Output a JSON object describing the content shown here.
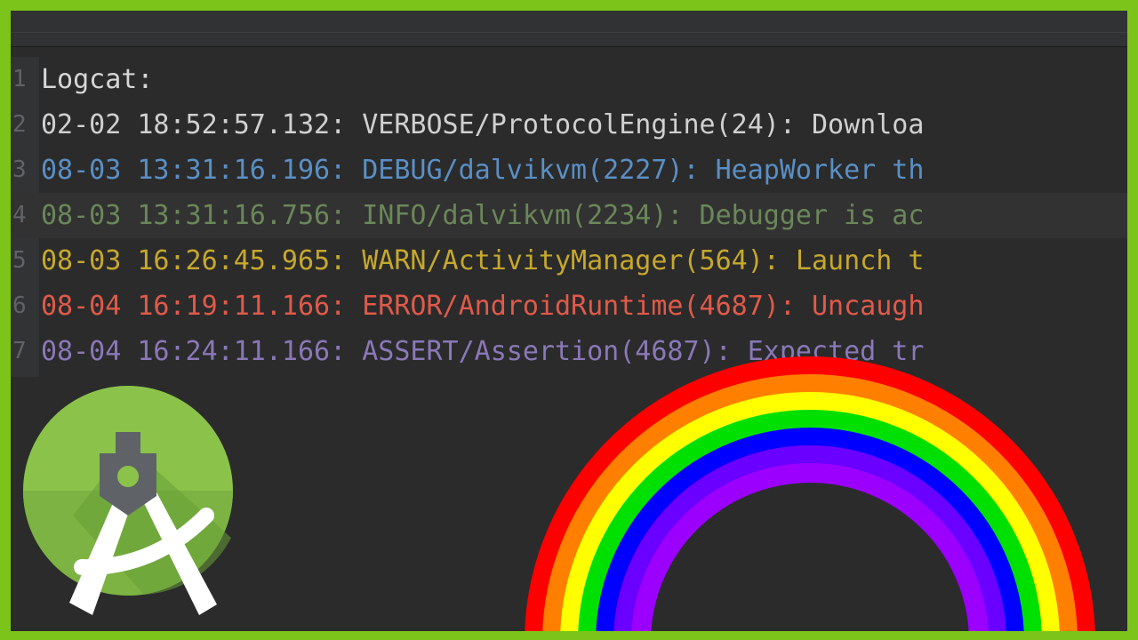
{
  "colors": {
    "border": "#7cc41a",
    "editor_bg": "#2b2b2b",
    "verbose": "#d0d0d0",
    "debug": "#5a8fc4",
    "info": "#6a8759",
    "warn": "#c6a82c",
    "error": "#e05a4a",
    "assert": "#8a78b8"
  },
  "editor": {
    "lines": [
      {
        "num": "1",
        "text": "Logcat:"
      },
      {
        "num": "2",
        "text": "02-02 18:52:57.132: VERBOSE/ProtocolEngine(24): Downloa"
      },
      {
        "num": "3",
        "text": "08-03 13:31:16.196: DEBUG/dalvikvm(2227): HeapWorker th"
      },
      {
        "num": "4",
        "text": "08-03 13:31:16.756: INFO/dalvikvm(2234): Debugger is ac"
      },
      {
        "num": "5",
        "text": "08-03 16:26:45.965: WARN/ActivityManager(564): Launch t"
      },
      {
        "num": "6",
        "text": "08-04 16:19:11.166: ERROR/AndroidRuntime(4687): Uncaugh"
      },
      {
        "num": "7",
        "text": "08-04 16:24:11.166: ASSERT/Assertion(4687): Expected tr"
      }
    ]
  },
  "icons": {
    "logo": "android-studio-logo-icon",
    "rainbow": "rainbow-icon"
  }
}
